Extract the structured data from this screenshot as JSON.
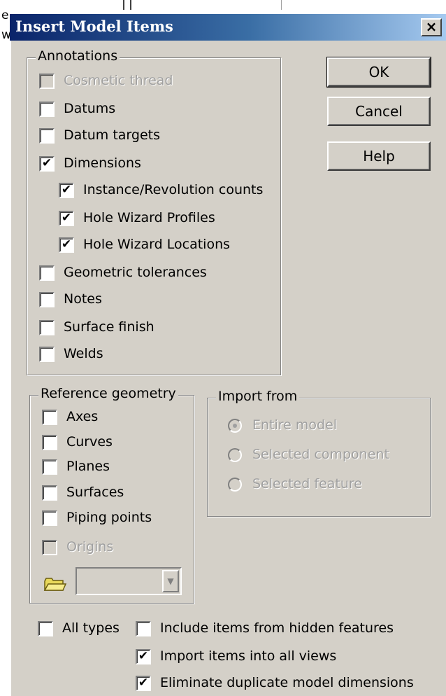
{
  "window": {
    "title": "Insert Model Items",
    "close_label": "×"
  },
  "background": {
    "left_chars": [
      "e",
      "w"
    ]
  },
  "buttons": {
    "ok": "OK",
    "cancel": "Cancel",
    "help": "Help"
  },
  "annotations": {
    "legend": "Annotations",
    "items": [
      {
        "label": "Cosmetic thread",
        "checked": false,
        "enabled": false
      },
      {
        "label": "Datums",
        "checked": false,
        "enabled": true
      },
      {
        "label": "Datum targets",
        "checked": false,
        "enabled": true
      },
      {
        "label": "Dimensions",
        "checked": true,
        "enabled": true
      },
      {
        "label": "Instance/Revolution counts",
        "checked": true,
        "enabled": true
      },
      {
        "label": "Hole Wizard Profiles",
        "checked": true,
        "enabled": true
      },
      {
        "label": "Hole Wizard Locations",
        "checked": true,
        "enabled": true
      },
      {
        "label": "Geometric tolerances",
        "checked": false,
        "enabled": true
      },
      {
        "label": "Notes",
        "checked": false,
        "enabled": true
      },
      {
        "label": "Surface finish",
        "checked": false,
        "enabled": true
      },
      {
        "label": "Welds",
        "checked": false,
        "enabled": true
      }
    ]
  },
  "reference_geometry": {
    "legend": "Reference geometry",
    "items": [
      {
        "label": "Axes",
        "checked": false,
        "enabled": true
      },
      {
        "label": "Curves",
        "checked": false,
        "enabled": true
      },
      {
        "label": "Planes",
        "checked": false,
        "enabled": true
      },
      {
        "label": "Surfaces",
        "checked": false,
        "enabled": true
      },
      {
        "label": "Piping points",
        "checked": false,
        "enabled": true
      },
      {
        "label": "Origins",
        "checked": false,
        "enabled": false
      }
    ],
    "dropdown_value": ""
  },
  "import_from": {
    "legend": "Import from",
    "options": [
      {
        "label": "Entire model",
        "selected": true,
        "enabled": false
      },
      {
        "label": "Selected component",
        "selected": false,
        "enabled": false
      },
      {
        "label": "Selected feature",
        "selected": false,
        "enabled": false
      }
    ]
  },
  "bottom": {
    "all_types": {
      "label": "All types",
      "checked": false
    },
    "include_hidden": {
      "label": "Include items from hidden features",
      "checked": false
    },
    "import_all_views": {
      "label": "Import items into all views",
      "checked": true
    },
    "eliminate_duplicates": {
      "label": "Eliminate duplicate model dimensions",
      "checked": true
    }
  },
  "check_glyph": "✔"
}
